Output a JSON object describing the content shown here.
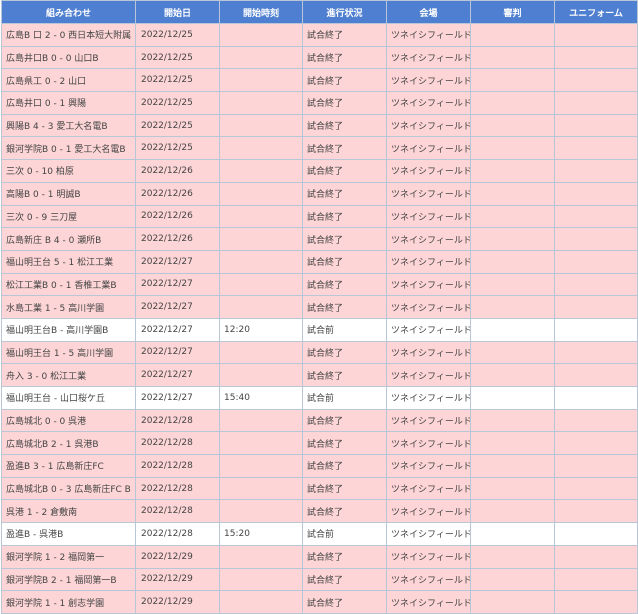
{
  "table": {
    "headers": [
      "組み合わせ",
      "開始日",
      "開始時刻",
      "進行状況",
      "会場",
      "審判",
      "ユニフォーム"
    ],
    "rows": [
      {
        "match": "広島B 口 2 - 0 西日本短大附属",
        "date": "2022/12/25",
        "time": "",
        "status": "試合終了",
        "venue": "ツネイシフィールドB",
        "referee": "",
        "uniform": ""
      },
      {
        "match": "広島井口B 0 - 0 山口B",
        "date": "2022/12/25",
        "time": "",
        "status": "試合終了",
        "venue": "ツネイシフィールドB",
        "referee": "",
        "uniform": ""
      },
      {
        "match": "広島県工 0 - 2 山口",
        "date": "2022/12/25",
        "time": "",
        "status": "試合終了",
        "venue": "ツネイシフィールドB",
        "referee": "",
        "uniform": ""
      },
      {
        "match": "広島井口 0 - 1 興陽",
        "date": "2022/12/25",
        "time": "",
        "status": "試合終了",
        "venue": "ツネイシフィールドB",
        "referee": "",
        "uniform": ""
      },
      {
        "match": "興陽B 4 - 3 愛工大名電B",
        "date": "2022/12/25",
        "time": "",
        "status": "試合終了",
        "venue": "ツネイシフィールドB",
        "referee": "",
        "uniform": ""
      },
      {
        "match": "銀河学院B 0 - 1 愛工大名電B",
        "date": "2022/12/25",
        "time": "",
        "status": "試合終了",
        "venue": "ツネイシフィールドB",
        "referee": "",
        "uniform": ""
      },
      {
        "match": "三次 0 - 10 柏原",
        "date": "2022/12/26",
        "time": "",
        "status": "試合終了",
        "venue": "ツネイシフィールドB",
        "referee": "",
        "uniform": ""
      },
      {
        "match": "高陽B 0 - 1 明誠B",
        "date": "2022/12/26",
        "time": "",
        "status": "試合終了",
        "venue": "ツネイシフィールドB",
        "referee": "",
        "uniform": ""
      },
      {
        "match": "三次 0 - 9 三刀屋",
        "date": "2022/12/26",
        "time": "",
        "status": "試合終了",
        "venue": "ツネイシフィールドB",
        "referee": "",
        "uniform": ""
      },
      {
        "match": "広島新庄 B 4 - 0 瀬所B",
        "date": "2022/12/26",
        "time": "",
        "status": "試合終了",
        "venue": "ツネイシフィールドB",
        "referee": "",
        "uniform": ""
      },
      {
        "match": "福山明王台 5 - 1 松江工業",
        "date": "2022/12/27",
        "time": "",
        "status": "試合終了",
        "venue": "ツネイシフィールドB",
        "referee": "",
        "uniform": ""
      },
      {
        "match": "松江工業B 0 - 1 香椎工業B",
        "date": "2022/12/27",
        "time": "",
        "status": "試合終了",
        "venue": "ツネイシフィールドB",
        "referee": "",
        "uniform": ""
      },
      {
        "match": "水島工業 1 - 5 高川学園",
        "date": "2022/12/27",
        "time": "",
        "status": "試合終了",
        "venue": "ツネイシフィールドB",
        "referee": "",
        "uniform": ""
      },
      {
        "match": "福山明王台B - 高川学園B",
        "date": "2022/12/27",
        "time": "12:20",
        "status": "試合前",
        "venue": "ツネイシフィールドB",
        "referee": "",
        "uniform": ""
      },
      {
        "match": "福山明王台 1 - 5 高川学園",
        "date": "2022/12/27",
        "time": "",
        "status": "試合終了",
        "venue": "ツネイシフィールドB",
        "referee": "",
        "uniform": ""
      },
      {
        "match": "舟入 3 - 0 松江工業",
        "date": "2022/12/27",
        "time": "",
        "status": "試合終了",
        "venue": "ツネイシフィールドB",
        "referee": "",
        "uniform": ""
      },
      {
        "match": "福山明王台 - 山口桜ケ丘",
        "date": "2022/12/27",
        "time": "15:40",
        "status": "試合前",
        "venue": "ツネイシフィールドB",
        "referee": "",
        "uniform": ""
      },
      {
        "match": "広島城北 0 - 0 呉港",
        "date": "2022/12/28",
        "time": "",
        "status": "試合終了",
        "venue": "ツネイシフィールドB",
        "referee": "",
        "uniform": ""
      },
      {
        "match": "広島城北B 2 - 1 呉港B",
        "date": "2022/12/28",
        "time": "",
        "status": "試合終了",
        "venue": "ツネイシフィールドB",
        "referee": "",
        "uniform": ""
      },
      {
        "match": "盈進B 3 - 1 広島新庄FC",
        "date": "2022/12/28",
        "time": "",
        "status": "試合終了",
        "venue": "ツネイシフィールドB",
        "referee": "",
        "uniform": ""
      },
      {
        "match": "広島城北B 0 - 3 広島新庄FC B",
        "date": "2022/12/28",
        "time": "",
        "status": "試合終了",
        "venue": "ツネイシフィールドB",
        "referee": "",
        "uniform": ""
      },
      {
        "match": "呉港 1 - 2 倉敷南",
        "date": "2022/12/28",
        "time": "",
        "status": "試合終了",
        "venue": "ツネイシフィールドB",
        "referee": "",
        "uniform": ""
      },
      {
        "match": "盈進B - 呉港B",
        "date": "2022/12/28",
        "time": "15:20",
        "status": "試合前",
        "venue": "ツネイシフィールドB",
        "referee": "",
        "uniform": ""
      },
      {
        "match": "銀河学院 1 - 2 福岡第一",
        "date": "2022/12/29",
        "time": "",
        "status": "試合終了",
        "venue": "ツネイシフィールドB",
        "referee": "",
        "uniform": ""
      },
      {
        "match": "銀河学院B 2 - 1 福岡第一B",
        "date": "2022/12/29",
        "time": "",
        "status": "試合終了",
        "venue": "ツネイシフィールドB",
        "referee": "",
        "uniform": ""
      },
      {
        "match": "銀河学院 1 - 1 創志学園",
        "date": "2022/12/29",
        "time": "",
        "status": "試合終了",
        "venue": "ツネイシフィールドB",
        "referee": "",
        "uniform": ""
      }
    ]
  }
}
